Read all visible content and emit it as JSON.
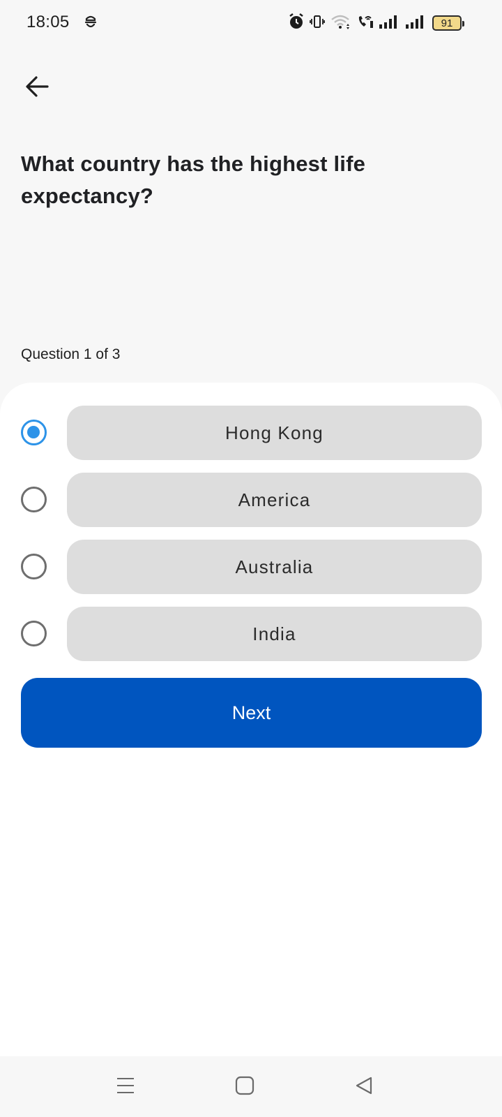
{
  "status_bar": {
    "time": "18:05",
    "battery_level": "91",
    "icons": [
      "notification-icon",
      "alarm-icon",
      "vibrate-icon",
      "wifi-icon",
      "wifi-calling-icon",
      "signal-icon",
      "signal-icon",
      "battery-icon"
    ]
  },
  "header": {
    "back_icon": "arrow-left-icon"
  },
  "quiz": {
    "question": "What country has the highest life expectancy?",
    "progress_text": "Question 1 of 3",
    "selected_index": 0,
    "options": [
      {
        "label": "Hong Kong",
        "selected": true
      },
      {
        "label": "America",
        "selected": false
      },
      {
        "label": "Australia",
        "selected": false
      },
      {
        "label": "India",
        "selected": false
      }
    ],
    "next_label": "Next"
  },
  "colors": {
    "accent": "#0055bf",
    "radio_selected": "#2d93e8",
    "option_background": "#dddddd",
    "page_background": "#f7f7f7"
  },
  "nav_bar": {
    "icons": [
      "menu-icon",
      "home-icon",
      "back-triangle-icon"
    ]
  }
}
